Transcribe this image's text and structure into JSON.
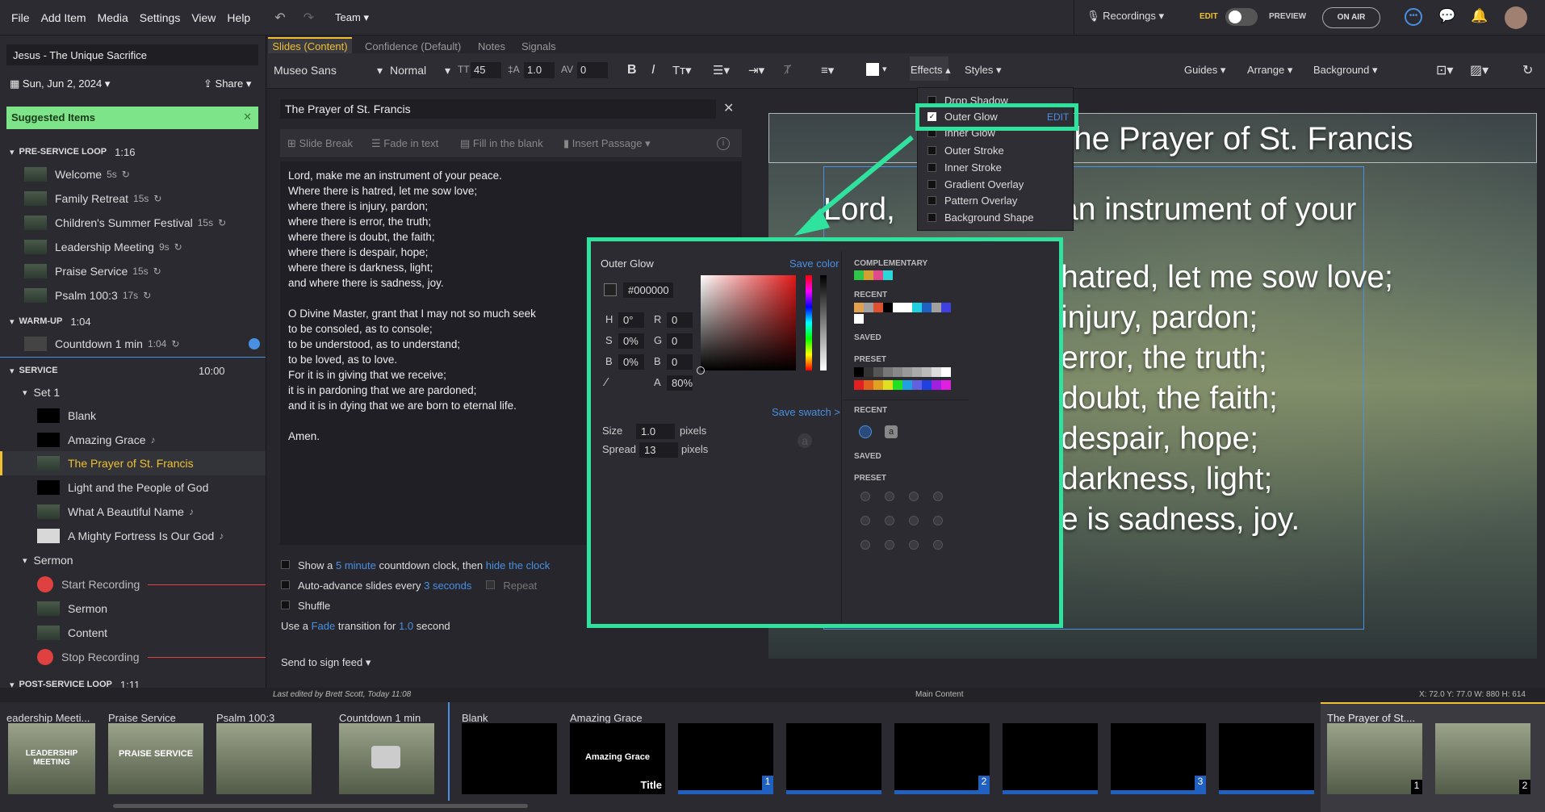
{
  "menu": {
    "file": "File",
    "add_item": "Add Item",
    "media": "Media",
    "settings": "Settings",
    "view": "View",
    "help": "Help",
    "team": "Team"
  },
  "header": {
    "recordings": "Recordings",
    "edit": "EDIT",
    "preview": "PREVIEW",
    "on_air": "ON AIR"
  },
  "plan": {
    "title": "Jesus - The Unique Sacrifice",
    "date": "Sun, Jun 2, 2024",
    "share": "Share",
    "suggested": "Suggested Items"
  },
  "sections": [
    {
      "name": "PRE-SERVICE LOOP",
      "time": "1:16"
    },
    {
      "name": "WARM-UP",
      "time": "1:04"
    },
    {
      "name": "SERVICE",
      "time": "10:00"
    },
    {
      "name": "POST-SERVICE LOOP",
      "time": "1:11"
    }
  ],
  "preservice": [
    {
      "label": "Welcome",
      "meta": "5s"
    },
    {
      "label": "Family Retreat",
      "meta": "15s"
    },
    {
      "label": "Children's Summer Festival",
      "meta": "15s"
    },
    {
      "label": "Leadership Meeting",
      "meta": "9s"
    },
    {
      "label": "Praise Service",
      "meta": "15s"
    },
    {
      "label": "Psalm 100:3",
      "meta": "17s"
    }
  ],
  "warmup": [
    {
      "label": "Countdown 1 min",
      "meta": "1:04"
    }
  ],
  "service": {
    "set": "Set 1",
    "items": [
      "Blank",
      "Amazing Grace",
      "The Prayer of St. Francis",
      "Light and the People of God",
      "What A Beautiful Name",
      "A Mighty Fortress Is Our God"
    ],
    "sermon": "Sermon",
    "sermon_items": [
      "Start Recording",
      "Sermon",
      "Content",
      "Stop Recording"
    ]
  },
  "editor": {
    "tabs": [
      "Slides (Content)",
      "Confidence (Default)",
      "Notes",
      "Signals"
    ],
    "font": "Museo Sans",
    "weight": "Normal",
    "size": "45",
    "line": "1.0",
    "spacing": "0",
    "effects": "Effects",
    "styles": "Styles",
    "guides": "Guides",
    "arrange": "Arrange",
    "background": "Background",
    "item_title": "The Prayer of St. Francis",
    "actions": [
      "Slide Break",
      "Fade in text",
      "Fill in the blank",
      "Insert Passage"
    ],
    "lyrics": "Lord, make me an instrument of your peace.\nWhere there is hatred, let me sow love;\nwhere there is injury, pardon;\nwhere there is error, the truth;\nwhere there is doubt, the faith;\nwhere there is despair, hope;\nwhere there is darkness, light;\nand where there is sadness, joy.\n\nO Divine Master, grant that I may not so much seek\nto be consoled, as to console;\nto be understood, as to understand;\nto be loved, as to love.\nFor it is in giving that we receive;\nit is in pardoning that we are pardoned;\nand it is in dying that we are born to eternal life.\n\nAmen.",
    "opt1a": "Show a",
    "opt1b": "5 minute",
    "opt1c": "countdown clock, then",
    "opt1d": "hide the clock",
    "opt2a": "Auto-advance slides every",
    "opt2b": "3 seconds",
    "opt2c": "Repeat",
    "opt3": "Shuffle",
    "opt4a": "Use a",
    "opt4b": "Fade",
    "opt4c": "transition for",
    "opt4d": "1.0",
    "opt4e": "second",
    "send": "Send to sign feed"
  },
  "effects_menu": {
    "items": [
      "Drop Shadow",
      "Outer Glow",
      "Inner Glow",
      "Outer Stroke",
      "Inner Stroke",
      "Gradient Overlay",
      "Pattern Overlay",
      "Background Shape"
    ],
    "edit": "EDIT"
  },
  "dialog": {
    "title": "Outer Glow",
    "save_color": "Save color",
    "hex": "#000000",
    "h": "0°",
    "s": "0%",
    "b": "0%",
    "r": "0",
    "g": "0",
    "bb": "0",
    "a": "80%",
    "save_swatch": "Save swatch >",
    "size_label": "Size",
    "size": "1.0",
    "spread_label": "Spread",
    "spread": "13",
    "pixels": "pixels",
    "complementary": "COMPLEMENTARY",
    "recent": "RECENT",
    "saved": "SAVED",
    "preset": "PRESET",
    "complementary_colors": [
      "#2fc44a",
      "#d4a030",
      "#e04a8a",
      "#2ad8d8"
    ],
    "recent_colors": [
      "#e0a050",
      "#a0a0a0",
      "#e05030",
      "#000000",
      "#ffffff",
      "#ffffff",
      "#20d0e0",
      "#2060c0",
      "#a0a0a0",
      "#4040e0",
      "#ffffff"
    ],
    "preset_grays": [
      "#000000",
      "#333333",
      "#555555",
      "#777777",
      "#888888",
      "#999999",
      "#aaaaaa",
      "#bbbbbb",
      "#dddddd",
      "#ffffff"
    ],
    "preset_colors": [
      "#e02020",
      "#e06020",
      "#e0a020",
      "#e0e020",
      "#20e020",
      "#20a0e0",
      "#6060e0",
      "#2040e0",
      "#a020e0",
      "#e020e0"
    ]
  },
  "canvas": {
    "title": "The Prayer of St. Francis",
    "l1a": "Lord,",
    "l1b": "an instrument of your",
    "l2": "hatred, let me sow love;",
    "l3": "injury, pardon;",
    "l4": "error, the truth;",
    "l5": "doubt, the faith;",
    "l6": "despair, hope;",
    "l7": "darkness, light;",
    "l8": "e is sadness, joy."
  },
  "status": {
    "edited": "Last edited by Brett Scott, Today 11:08",
    "layer": "Main Content",
    "coords": "X: 72.0 Y: 77.0 W: 880 H: 614"
  },
  "strip": {
    "items": [
      "eadership Meeti...",
      "Praise Service",
      "Psalm 100:3",
      "Countdown 1 min",
      "Blank",
      "Amazing Grace",
      "The Prayer of St...."
    ],
    "t_leadership": "LEADERSHIP MEETING",
    "t_praise": "PRAISE SERVICE",
    "t_amazing": "Amazing Grace",
    "t_title": "Title",
    "n1": "1",
    "n2": "2",
    "n3": "3"
  },
  "colors": {
    "accent": "#2fe39f",
    "link": "#4a90e2",
    "selected": "#f0c030",
    "record": "#e04040"
  }
}
